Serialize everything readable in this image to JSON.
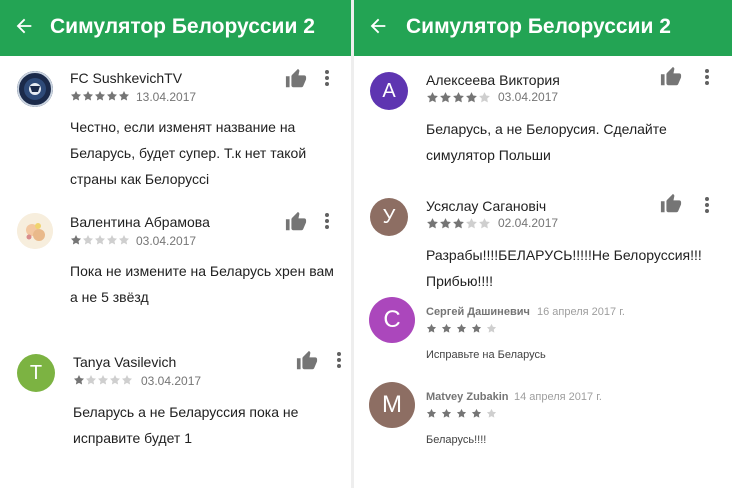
{
  "app_title": "Симулятор Белоруссии 2",
  "icons": {
    "back": "arrow-back-icon",
    "like": "thumb-up-icon",
    "more": "more-vert-icon"
  },
  "colors": {
    "app_bar": "#23a454",
    "star_filled": "#757575",
    "star_empty": "#cfcfcf"
  },
  "left_reviews": [
    {
      "author": "FC SushkevichTV",
      "date": "13.04.2017",
      "rating": 5,
      "text": "Честно, если изменят название на Беларусь, будет супер. Т.к нет такой страны как Белоруссi",
      "avatar": {
        "type": "logo"
      }
    },
    {
      "author": "Валентина Абрамова",
      "date": "03.04.2017",
      "rating": 1,
      "text": "Пока не измените на Беларусь хрен вам а не 5 звёзд",
      "avatar": {
        "type": "photo"
      }
    },
    {
      "author": "Tanya Vasilevich",
      "date": "03.04.2017",
      "rating": 1,
      "text": "Беларусь а не Беларуссия пока не исправите будет 1",
      "avatar": {
        "type": "letter",
        "letter": "T",
        "color": "#7cb342"
      }
    }
  ],
  "right_reviews": [
    {
      "author": "Алексеева Виктория",
      "date": "03.04.2017",
      "rating": 4,
      "text": "Беларусь, а не Белорусия. Сделайте симулятор Польши",
      "avatar": {
        "type": "letter",
        "letter": "А",
        "color": "#5e35b1"
      }
    },
    {
      "author": "Усяслау Сагановiч",
      "date": "02.04.2017",
      "rating": 3,
      "text": "Разрабы!!!!БЕЛАРУСЬ!!!!!Не Белоруссия!!! Прибью!!!!",
      "avatar": {
        "type": "letter",
        "letter": "У",
        "color": "#8d6e63"
      }
    },
    {
      "author": "Сергей Дашиневич",
      "date": "16 апреля 2017 г.",
      "rating": 4,
      "text": "Исправьте на Беларусь",
      "avatar": {
        "type": "letter",
        "letter": "С",
        "color": "#ab47bc"
      }
    },
    {
      "author": "Matvey Zubakin",
      "date": "14 апреля 2017 г.",
      "rating": 4,
      "text": "Беларусь!!!!",
      "avatar": {
        "type": "letter",
        "letter": "М",
        "color": "#8d6e63"
      }
    }
  ]
}
